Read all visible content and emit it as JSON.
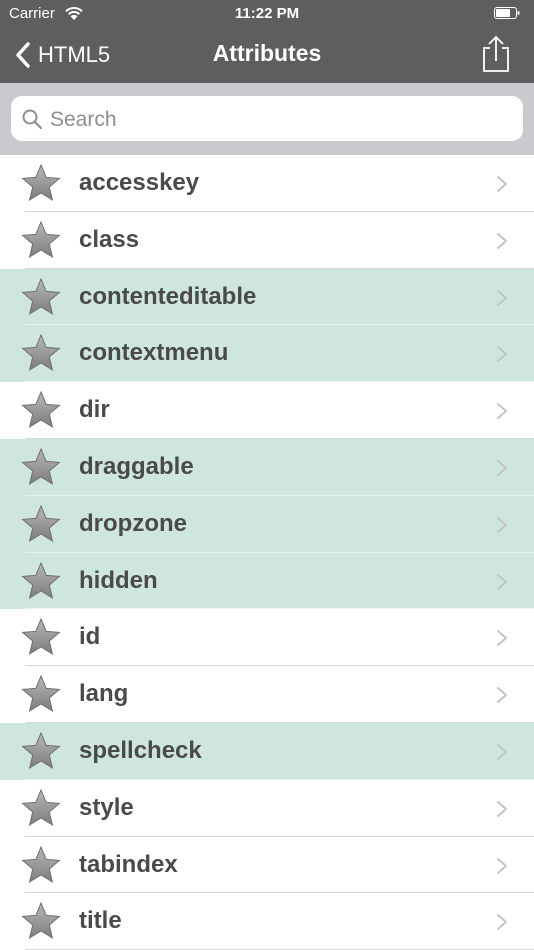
{
  "status_bar": {
    "carrier": "Carrier",
    "time": "11:22 PM"
  },
  "nav": {
    "back_label": "HTML5",
    "title": "Attributes"
  },
  "search": {
    "placeholder": "Search",
    "value": ""
  },
  "items": [
    {
      "label": "accesskey",
      "highlighted": false
    },
    {
      "label": "class",
      "highlighted": false
    },
    {
      "label": "contenteditable",
      "highlighted": true
    },
    {
      "label": "contextmenu",
      "highlighted": true
    },
    {
      "label": "dir",
      "highlighted": false
    },
    {
      "label": "draggable",
      "highlighted": true
    },
    {
      "label": "dropzone",
      "highlighted": true
    },
    {
      "label": "hidden",
      "highlighted": true
    },
    {
      "label": "id",
      "highlighted": false
    },
    {
      "label": "lang",
      "highlighted": false
    },
    {
      "label": "spellcheck",
      "highlighted": true
    },
    {
      "label": "style",
      "highlighted": false
    },
    {
      "label": "tabindex",
      "highlighted": false
    },
    {
      "label": "title",
      "highlighted": false
    }
  ],
  "colors": {
    "bar": "#5e5e5e",
    "highlight": "#cfe6e0",
    "star": "#8f8f8f",
    "label": "#4a4a4a"
  },
  "icons": {
    "row_icon": "star-icon",
    "row_accessory": "chevron-right-icon"
  }
}
